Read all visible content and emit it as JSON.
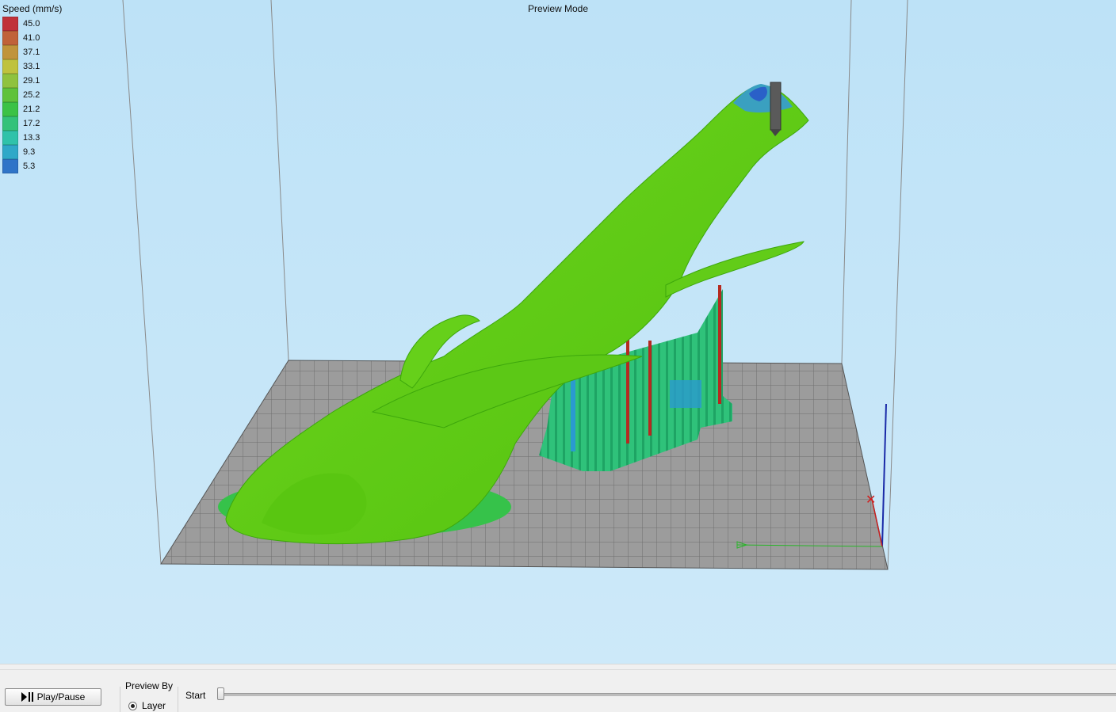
{
  "viewport": {
    "mode_title": "Preview Mode"
  },
  "legend": {
    "title": "Speed (mm/s)",
    "items": [
      {
        "value": "45.0",
        "color": "#c0313a"
      },
      {
        "value": "41.0",
        "color": "#c0623a"
      },
      {
        "value": "37.1",
        "color": "#c0943c"
      },
      {
        "value": "33.1",
        "color": "#bfc23e"
      },
      {
        "value": "29.1",
        "color": "#8fc23e"
      },
      {
        "value": "25.2",
        "color": "#5fc23c"
      },
      {
        "value": "21.2",
        "color": "#3bc246"
      },
      {
        "value": "17.2",
        "color": "#33c27a"
      },
      {
        "value": "13.3",
        "color": "#2fc2aa"
      },
      {
        "value": "9.3",
        "color": "#2fa8c8"
      },
      {
        "value": "5.3",
        "color": "#2f74c8"
      }
    ]
  },
  "controls": {
    "play_pause_label": "Play/Pause",
    "preview_by_title": "Preview By",
    "layer_option": "Layer",
    "start_label": "Start"
  }
}
